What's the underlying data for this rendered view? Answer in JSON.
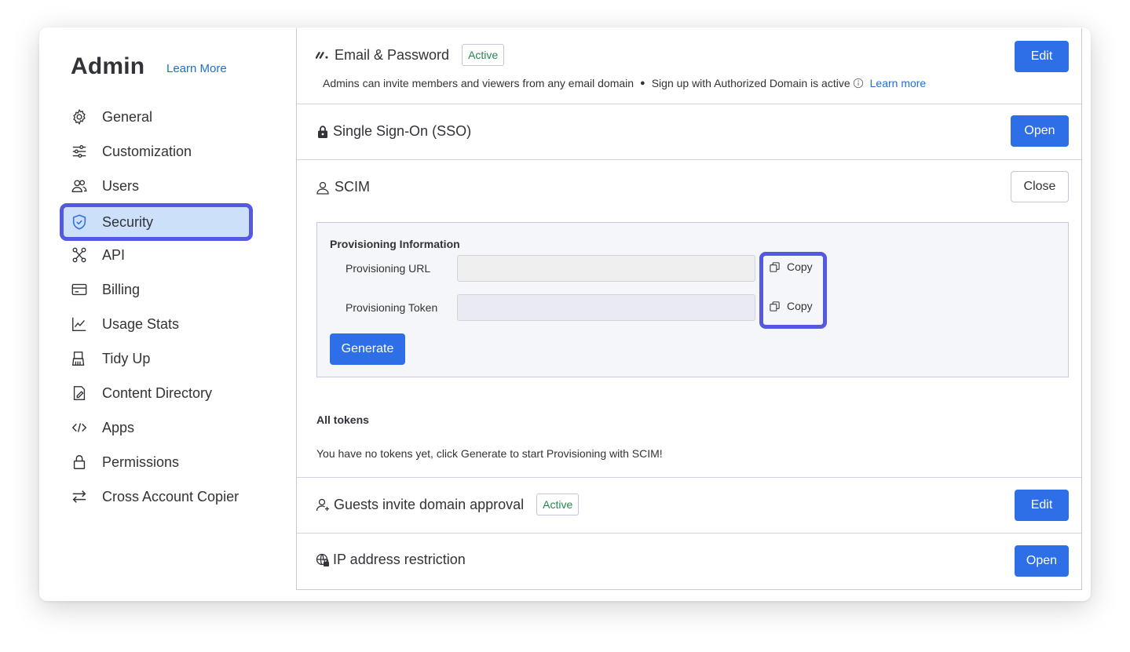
{
  "sidebar": {
    "title": "Admin",
    "learn_more": "Learn More",
    "items": [
      {
        "label": "General",
        "icon": "gear-icon"
      },
      {
        "label": "Customization",
        "icon": "sliders-icon"
      },
      {
        "label": "Users",
        "icon": "users-icon"
      },
      {
        "label": "Security",
        "icon": "shield-icon",
        "active": true
      },
      {
        "label": "API",
        "icon": "api-icon"
      },
      {
        "label": "Billing",
        "icon": "credit-card-icon"
      },
      {
        "label": "Usage Stats",
        "icon": "chart-icon"
      },
      {
        "label": "Tidy Up",
        "icon": "broom-icon"
      },
      {
        "label": "Content Directory",
        "icon": "document-icon"
      },
      {
        "label": "Apps",
        "icon": "code-icon"
      },
      {
        "label": "Permissions",
        "icon": "lock-icon"
      },
      {
        "label": "Cross Account Copier",
        "icon": "swap-arrows-icon"
      }
    ]
  },
  "sections": {
    "email": {
      "title": "Email & Password",
      "badge": "Active",
      "desc_part1": "Admins can invite members and viewers from any email domain",
      "desc_bullet": "●",
      "desc_part2": "Sign up with Authorized Domain is active",
      "learn_more": "Learn more",
      "button": "Edit"
    },
    "sso": {
      "title": "Single Sign-On (SSO)",
      "button": "Open"
    },
    "scim": {
      "title": "SCIM",
      "button": "Close",
      "provisioning_title": "Provisioning Information",
      "url_label": "Provisioning URL",
      "url_value": "",
      "token_label": "Provisioning Token",
      "token_value": "",
      "copy_label": "Copy",
      "generate_label": "Generate",
      "all_tokens_title": "All tokens",
      "no_tokens_text": "You have no tokens yet, click Generate to start Provisioning with SCIM!"
    },
    "guests": {
      "title": "Guests invite domain approval",
      "badge": "Active",
      "button": "Edit"
    },
    "ip": {
      "title": "IP address restriction",
      "button": "Open"
    }
  },
  "colors": {
    "accent": "#2e6ee6",
    "highlight": "#5559df",
    "active_bg": "#cce0f9",
    "badge_text": "#258750",
    "link": "#1f6fd0"
  }
}
